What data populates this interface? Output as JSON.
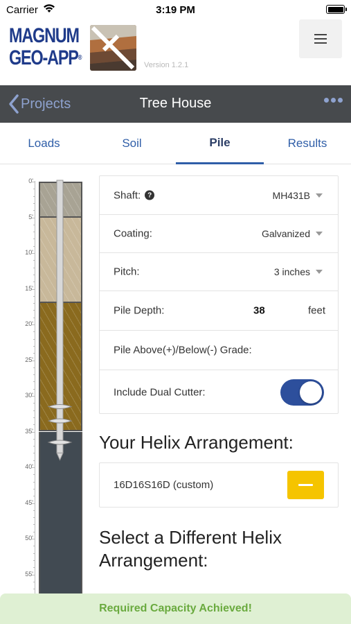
{
  "status_bar": {
    "carrier": "Carrier",
    "time": "3:19 PM"
  },
  "header": {
    "logo_line1": "MAGNUM",
    "logo_line2": "GEO-APP",
    "logo_mark": "®",
    "version": "Version 1.2.1",
    "menu_icon": "hamburger-icon"
  },
  "navbar": {
    "back_label": "Projects",
    "title": "Tree House",
    "more_icon": "ellipsis-icon"
  },
  "tabs": [
    {
      "label": "Loads"
    },
    {
      "label": "Soil"
    },
    {
      "label": "Pile",
      "active": true
    },
    {
      "label": "Results"
    }
  ],
  "depth_scale": [
    "0'",
    "5'",
    "10'",
    "15'",
    "20'",
    "25'",
    "30'",
    "35'",
    "40'",
    "45'",
    "50'",
    "55'"
  ],
  "soil_layers": [
    {
      "from_ft": 0,
      "to_ft": 5,
      "color": "#a8a394"
    },
    {
      "from_ft": 5,
      "to_ft": 17,
      "color": "#c8b89a"
    },
    {
      "from_ft": 17,
      "to_ft": 35,
      "color": "#8a6a1e"
    },
    {
      "from_ft": 35,
      "to_ft": 58,
      "color": "#414a52"
    }
  ],
  "pile": {
    "depth_ft": 38,
    "helix_depths_ft": [
      31.5,
      33.5,
      36.5
    ]
  },
  "form": {
    "shaft_label": "Shaft:",
    "shaft_value": "MH431B",
    "coating_label": "Coating:",
    "coating_value": "Galvanized",
    "pitch_label": "Pitch:",
    "pitch_value": "3 inches",
    "depth_label": "Pile Depth:",
    "depth_value": "38",
    "depth_unit": "feet",
    "grade_label": "Pile Above(+)/Below(-) Grade:",
    "dual_cutter_label": "Include Dual Cutter:",
    "dual_cutter_on": true
  },
  "helix": {
    "heading": "Your Helix Arrangement:",
    "value": "16D16S16D (custom)",
    "select_heading": "Select a Different Helix Arrangement:"
  },
  "banner": {
    "text": "Required Capacity Achieved!",
    "color": "#dff0d3"
  }
}
